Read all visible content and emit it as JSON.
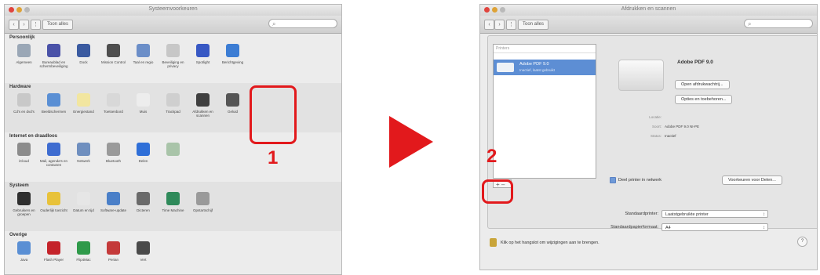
{
  "left_window": {
    "title": "Systeemvoorkeuren",
    "show_all": "Toon alles",
    "search_placeholder": "",
    "sections": [
      {
        "title": "Persoonlijk",
        "items": [
          {
            "label": "Algemeen",
            "icon": "general-icon",
            "color": "#9aa7b6"
          },
          {
            "label": "Bureaublad en schermbeveiliging",
            "icon": "desktop-icon",
            "color": "#4a52a8"
          },
          {
            "label": "Dock",
            "icon": "dock-icon",
            "color": "#3a5aa0"
          },
          {
            "label": "Mission Control",
            "icon": "mission-control-icon",
            "color": "#4e4e4e"
          },
          {
            "label": "Taal en regio",
            "icon": "language-icon",
            "color": "#6b8ec8"
          },
          {
            "label": "Beveiliging en privacy",
            "icon": "security-icon",
            "color": "#c7c7c7"
          },
          {
            "label": "Spotlight",
            "icon": "spotlight-icon",
            "color": "#3758c4"
          },
          {
            "label": "Berichtgeving",
            "icon": "notifications-icon",
            "color": "#3c7dd4"
          }
        ]
      },
      {
        "title": "Hardware",
        "items": [
          {
            "label": "Cd's en dvd's",
            "icon": "cd-icon",
            "color": "#c8c8c8"
          },
          {
            "label": "Beeldschermen",
            "icon": "displays-icon",
            "color": "#5a8fd4"
          },
          {
            "label": "Energiestand",
            "icon": "energy-icon",
            "color": "#f2e6a0"
          },
          {
            "label": "Toetsenbord",
            "icon": "keyboard-icon",
            "color": "#d8d8d8"
          },
          {
            "label": "Muis",
            "icon": "mouse-icon",
            "color": "#ededed"
          },
          {
            "label": "Trackpad",
            "icon": "trackpad-icon",
            "color": "#cfcfcf"
          },
          {
            "label": "Afdrukken en scannen",
            "icon": "printer-icon",
            "color": "#3f3f3f"
          },
          {
            "label": "Geluid",
            "icon": "sound-icon",
            "color": "#555555"
          }
        ]
      },
      {
        "title": "Internet en draadloos",
        "items": [
          {
            "label": "iCloud",
            "icon": "icloud-icon",
            "color": "#8c8c8c"
          },
          {
            "label": "Mail, agenda's en contacten",
            "icon": "mail-icon",
            "color": "#3e6cd0"
          },
          {
            "label": "Netwerk",
            "icon": "network-icon",
            "color": "#6f8fbf"
          },
          {
            "label": "Bluetooth",
            "icon": "bluetooth-icon",
            "color": "#9a9a9a"
          },
          {
            "label": "Delen",
            "icon": "sharing-icon",
            "color": "#2f6fd8"
          },
          {
            "label": "",
            "icon": "folder-icon",
            "color": "#a9c4a9"
          }
        ]
      },
      {
        "title": "Systeem",
        "items": [
          {
            "label": "Gebruikers en groepen",
            "icon": "users-icon",
            "color": "#2e2e2e"
          },
          {
            "label": "Ouderlijk toezicht",
            "icon": "parental-icon",
            "color": "#e8c23a"
          },
          {
            "label": "Datum en tijd",
            "icon": "clock-icon",
            "color": "#e6e6e6"
          },
          {
            "label": "Software-update",
            "icon": "update-icon",
            "color": "#4a7fc8"
          },
          {
            "label": "Dicteren",
            "icon": "microphone-icon",
            "color": "#6a6a6a"
          },
          {
            "label": "Time Machine",
            "icon": "time-machine-icon",
            "color": "#2f8a5a"
          },
          {
            "label": "Opstartschijf",
            "icon": "disk-icon",
            "color": "#9a9a9a"
          }
        ]
      },
      {
        "title": "Overige",
        "items": [
          {
            "label": "Java",
            "icon": "java-icon",
            "color": "#5a8fd4"
          },
          {
            "label": "Flash Player",
            "icon": "flash-icon",
            "color": "#c4232a"
          },
          {
            "label": "Flip4Mac",
            "icon": "flip4mac-icon",
            "color": "#2f9a4a"
          },
          {
            "label": "Perian",
            "icon": "perian-icon",
            "color": "#c43a3a"
          },
          {
            "label": "Vert",
            "icon": "shield-icon",
            "color": "#4a4a4a"
          }
        ]
      }
    ]
  },
  "right_window": {
    "title": "Afdrukken en scannen",
    "show_all": "Toon alles",
    "search_placeholder": "",
    "list_header": "Printers",
    "printer_name": "Adobe PDF 9.0",
    "printer_status": "Inactief, laatst gebruikt",
    "add_remove": "+ –",
    "detail_title": "Adobe PDF 9.0",
    "open_queue_button": "Open afdrukwachtrij...",
    "options_button": "Opties en toebehoren...",
    "location_label": "Locatie:",
    "kind_label": "Soort:",
    "kind_value": "Adobe PDF 9.0 NI-PE",
    "status_label": "Status:",
    "status_value": "Inactief",
    "share_label": "Deel printer in netwerk",
    "sharing_prefs_button": "Voorkeuren voor Delen...",
    "default_printer_label": "Standaardprinter:",
    "default_printer_value": "Laatstgebruikte printer",
    "paper_size_label": "Standaardpapierformaat:",
    "paper_size_value": "A4",
    "lock_text": "Klik op het hangslot om wijzigingen aan te brengen.",
    "help_label": "?"
  },
  "annotations": {
    "step1": "1",
    "step2": "2"
  },
  "colors": {
    "callout": "#e2191c",
    "selection": "#5d8ed4"
  }
}
